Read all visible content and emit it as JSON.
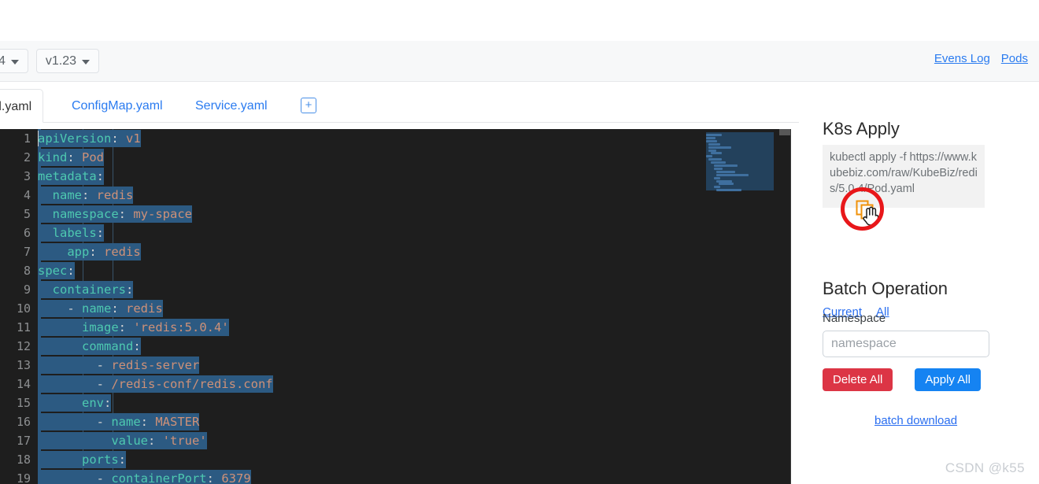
{
  "toolbar": {
    "dropdowns": [
      {
        "name": "version-minor-dropdown",
        "label": "4"
      },
      {
        "name": "k8s-version-dropdown",
        "label": "v1.23"
      }
    ],
    "links": [
      {
        "name": "events-log-link",
        "label": "Evens Log"
      },
      {
        "name": "pods-link",
        "label": "Pods"
      }
    ]
  },
  "tabs": {
    "items": [
      {
        "label": "d.yaml",
        "active": true
      },
      {
        "label": "ConfigMap.yaml",
        "active": false
      },
      {
        "label": "Service.yaml",
        "active": false
      }
    ],
    "add_label": "+"
  },
  "editor": {
    "language": "yaml",
    "selection_active": true,
    "lines": [
      {
        "n": "1",
        "indent": 0,
        "key": "apiVersion",
        "sep": ": ",
        "value": "v1",
        "dash": false,
        "selected": true
      },
      {
        "n": "2",
        "indent": 0,
        "key": "kind",
        "sep": ": ",
        "value": "Pod",
        "dash": false,
        "selected": true
      },
      {
        "n": "3",
        "indent": 0,
        "key": "metadata",
        "sep": ":",
        "value": "",
        "dash": false,
        "selected": true
      },
      {
        "n": "4",
        "indent": 2,
        "key": "name",
        "sep": ": ",
        "value": "redis",
        "dash": false,
        "selected": true
      },
      {
        "n": "5",
        "indent": 2,
        "key": "namespace",
        "sep": ": ",
        "value": "my-space",
        "dash": false,
        "selected": true
      },
      {
        "n": "6",
        "indent": 2,
        "key": "labels",
        "sep": ":",
        "value": "",
        "dash": false,
        "selected": true
      },
      {
        "n": "7",
        "indent": 4,
        "key": "app",
        "sep": ": ",
        "value": "redis",
        "dash": false,
        "selected": true
      },
      {
        "n": "8",
        "indent": 0,
        "key": "spec",
        "sep": ":",
        "value": "",
        "dash": false,
        "selected": true
      },
      {
        "n": "9",
        "indent": 2,
        "key": "containers",
        "sep": ":",
        "value": "",
        "dash": false,
        "selected": true
      },
      {
        "n": "10",
        "indent": 4,
        "key": "name",
        "sep": ": ",
        "value": "redis",
        "dash": true,
        "selected": true
      },
      {
        "n": "11",
        "indent": 6,
        "key": "image",
        "sep": ": ",
        "value": "'redis:5.0.4'",
        "dash": false,
        "selected": true
      },
      {
        "n": "12",
        "indent": 6,
        "key": "command",
        "sep": ":",
        "value": "",
        "dash": false,
        "selected": true
      },
      {
        "n": "13",
        "indent": 8,
        "key": "",
        "sep": "",
        "value": "redis-server",
        "dash": true,
        "selected": true
      },
      {
        "n": "14",
        "indent": 8,
        "key": "",
        "sep": "",
        "value": "/redis-conf/redis.conf",
        "dash": true,
        "selected": true
      },
      {
        "n": "15",
        "indent": 6,
        "key": "env",
        "sep": ":",
        "value": "",
        "dash": false,
        "selected": true
      },
      {
        "n": "16",
        "indent": 8,
        "key": "name",
        "sep": ": ",
        "value": "MASTER",
        "dash": true,
        "selected": true
      },
      {
        "n": "17",
        "indent": 10,
        "key": "value",
        "sep": ": ",
        "value": "'true'",
        "dash": false,
        "selected": true
      },
      {
        "n": "18",
        "indent": 6,
        "key": "ports",
        "sep": ":",
        "value": "",
        "dash": false,
        "selected": true
      },
      {
        "n": "19",
        "indent": 8,
        "key": "containerPort",
        "sep": ": ",
        "value": "6379",
        "dash": true,
        "selected": true
      }
    ]
  },
  "right_panel": {
    "k8s_apply": {
      "title": "K8s Apply",
      "command": "kubectl apply -f https://www.kubebiz.com/raw/KubeBiz/redis/5.0.4/Pod.yaml",
      "copy_icon": "copy-icon",
      "links": [
        {
          "name": "apply-current-link",
          "label": "Current"
        },
        {
          "name": "apply-all-link",
          "label": "All"
        }
      ]
    },
    "batch_operation": {
      "title": "Batch Operation",
      "namespace_label": "Namespace",
      "namespace_value": "",
      "namespace_placeholder": "namespace",
      "delete_all_label": "Delete All",
      "apply_all_label": "Apply All",
      "batch_download_label": "batch download"
    }
  },
  "annotation": {
    "type": "red-circle-highlight",
    "target": "copy-icon"
  },
  "watermark": "CSDN @k55",
  "colors": {
    "accent_blue": "#2a7bf0",
    "danger_red": "#dc3545",
    "primary_blue": "#1583f2",
    "editor_bg": "#1e1e1e",
    "selection_blue": "#2c5a82",
    "yaml_key": "#4ec9b0",
    "yaml_value": "#ce9178",
    "annotation_red": "#e8171a",
    "copy_icon_orange": "#f0920a"
  }
}
